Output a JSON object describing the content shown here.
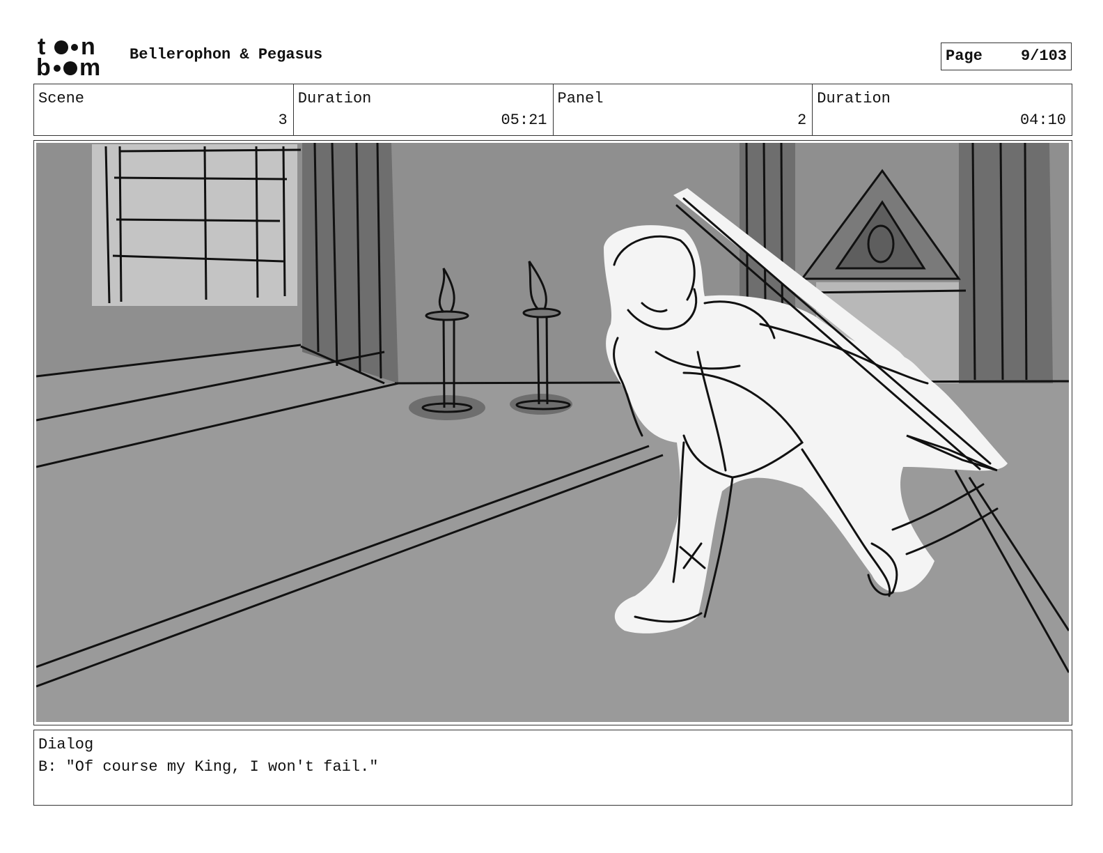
{
  "header": {
    "project_title": "Bellerophon & Pegasus",
    "page_label": "Page",
    "page_value": "9/103"
  },
  "info": {
    "scene_label": "Scene",
    "scene_value": "3",
    "scene_duration_label": "Duration",
    "scene_duration_value": "05:21",
    "panel_label": "Panel",
    "panel_value": "2",
    "panel_duration_label": "Duration",
    "panel_duration_value": "04:10"
  },
  "dialog": {
    "label": "Dialog",
    "text": "B: \"Of course my King, I won't fail.\""
  },
  "colors": {
    "ink": "#111111",
    "floor": "#9a9a9a",
    "wall": "#8f8f8f",
    "shadow": "#6e6e6e",
    "window": "#c4c4c4",
    "figure": "#f4f4f4"
  }
}
